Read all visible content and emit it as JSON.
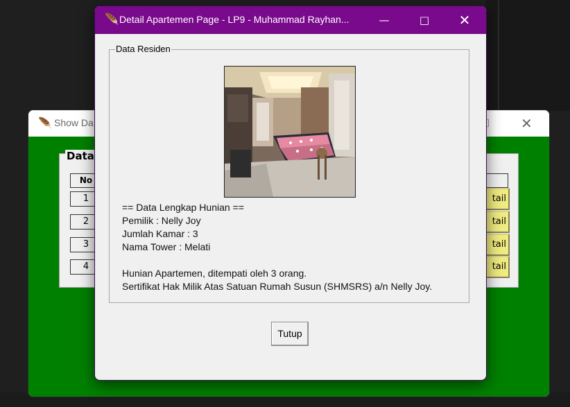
{
  "back_window": {
    "title": "Show Da",
    "frame_label": "Data",
    "no_header": "No",
    "rows": [
      "1",
      "2",
      "3",
      "4"
    ],
    "detail_label": "tail",
    "background_color": "#008000"
  },
  "window": {
    "title": "Detail Apartemen Page - LP9 - Muhammad Rayhan...",
    "titlebar_color": "#7a0a8c"
  },
  "frame": {
    "label": "Data Residen"
  },
  "info": {
    "heading": "== Data Lengkap Hunian ==",
    "owner": "Pemilik : Nelly Joy",
    "rooms": "Jumlah Kamar : 3",
    "tower": "Nama Tower : Melati",
    "occupancy": "Hunian Apartemen, ditempati oleh 3 orang.",
    "certificate": "Sertifikat Hak Milik Atas Satuan Rumah Susun (SHMSRS) a/n Nelly Joy."
  },
  "button": {
    "close_label": "Tutup"
  }
}
